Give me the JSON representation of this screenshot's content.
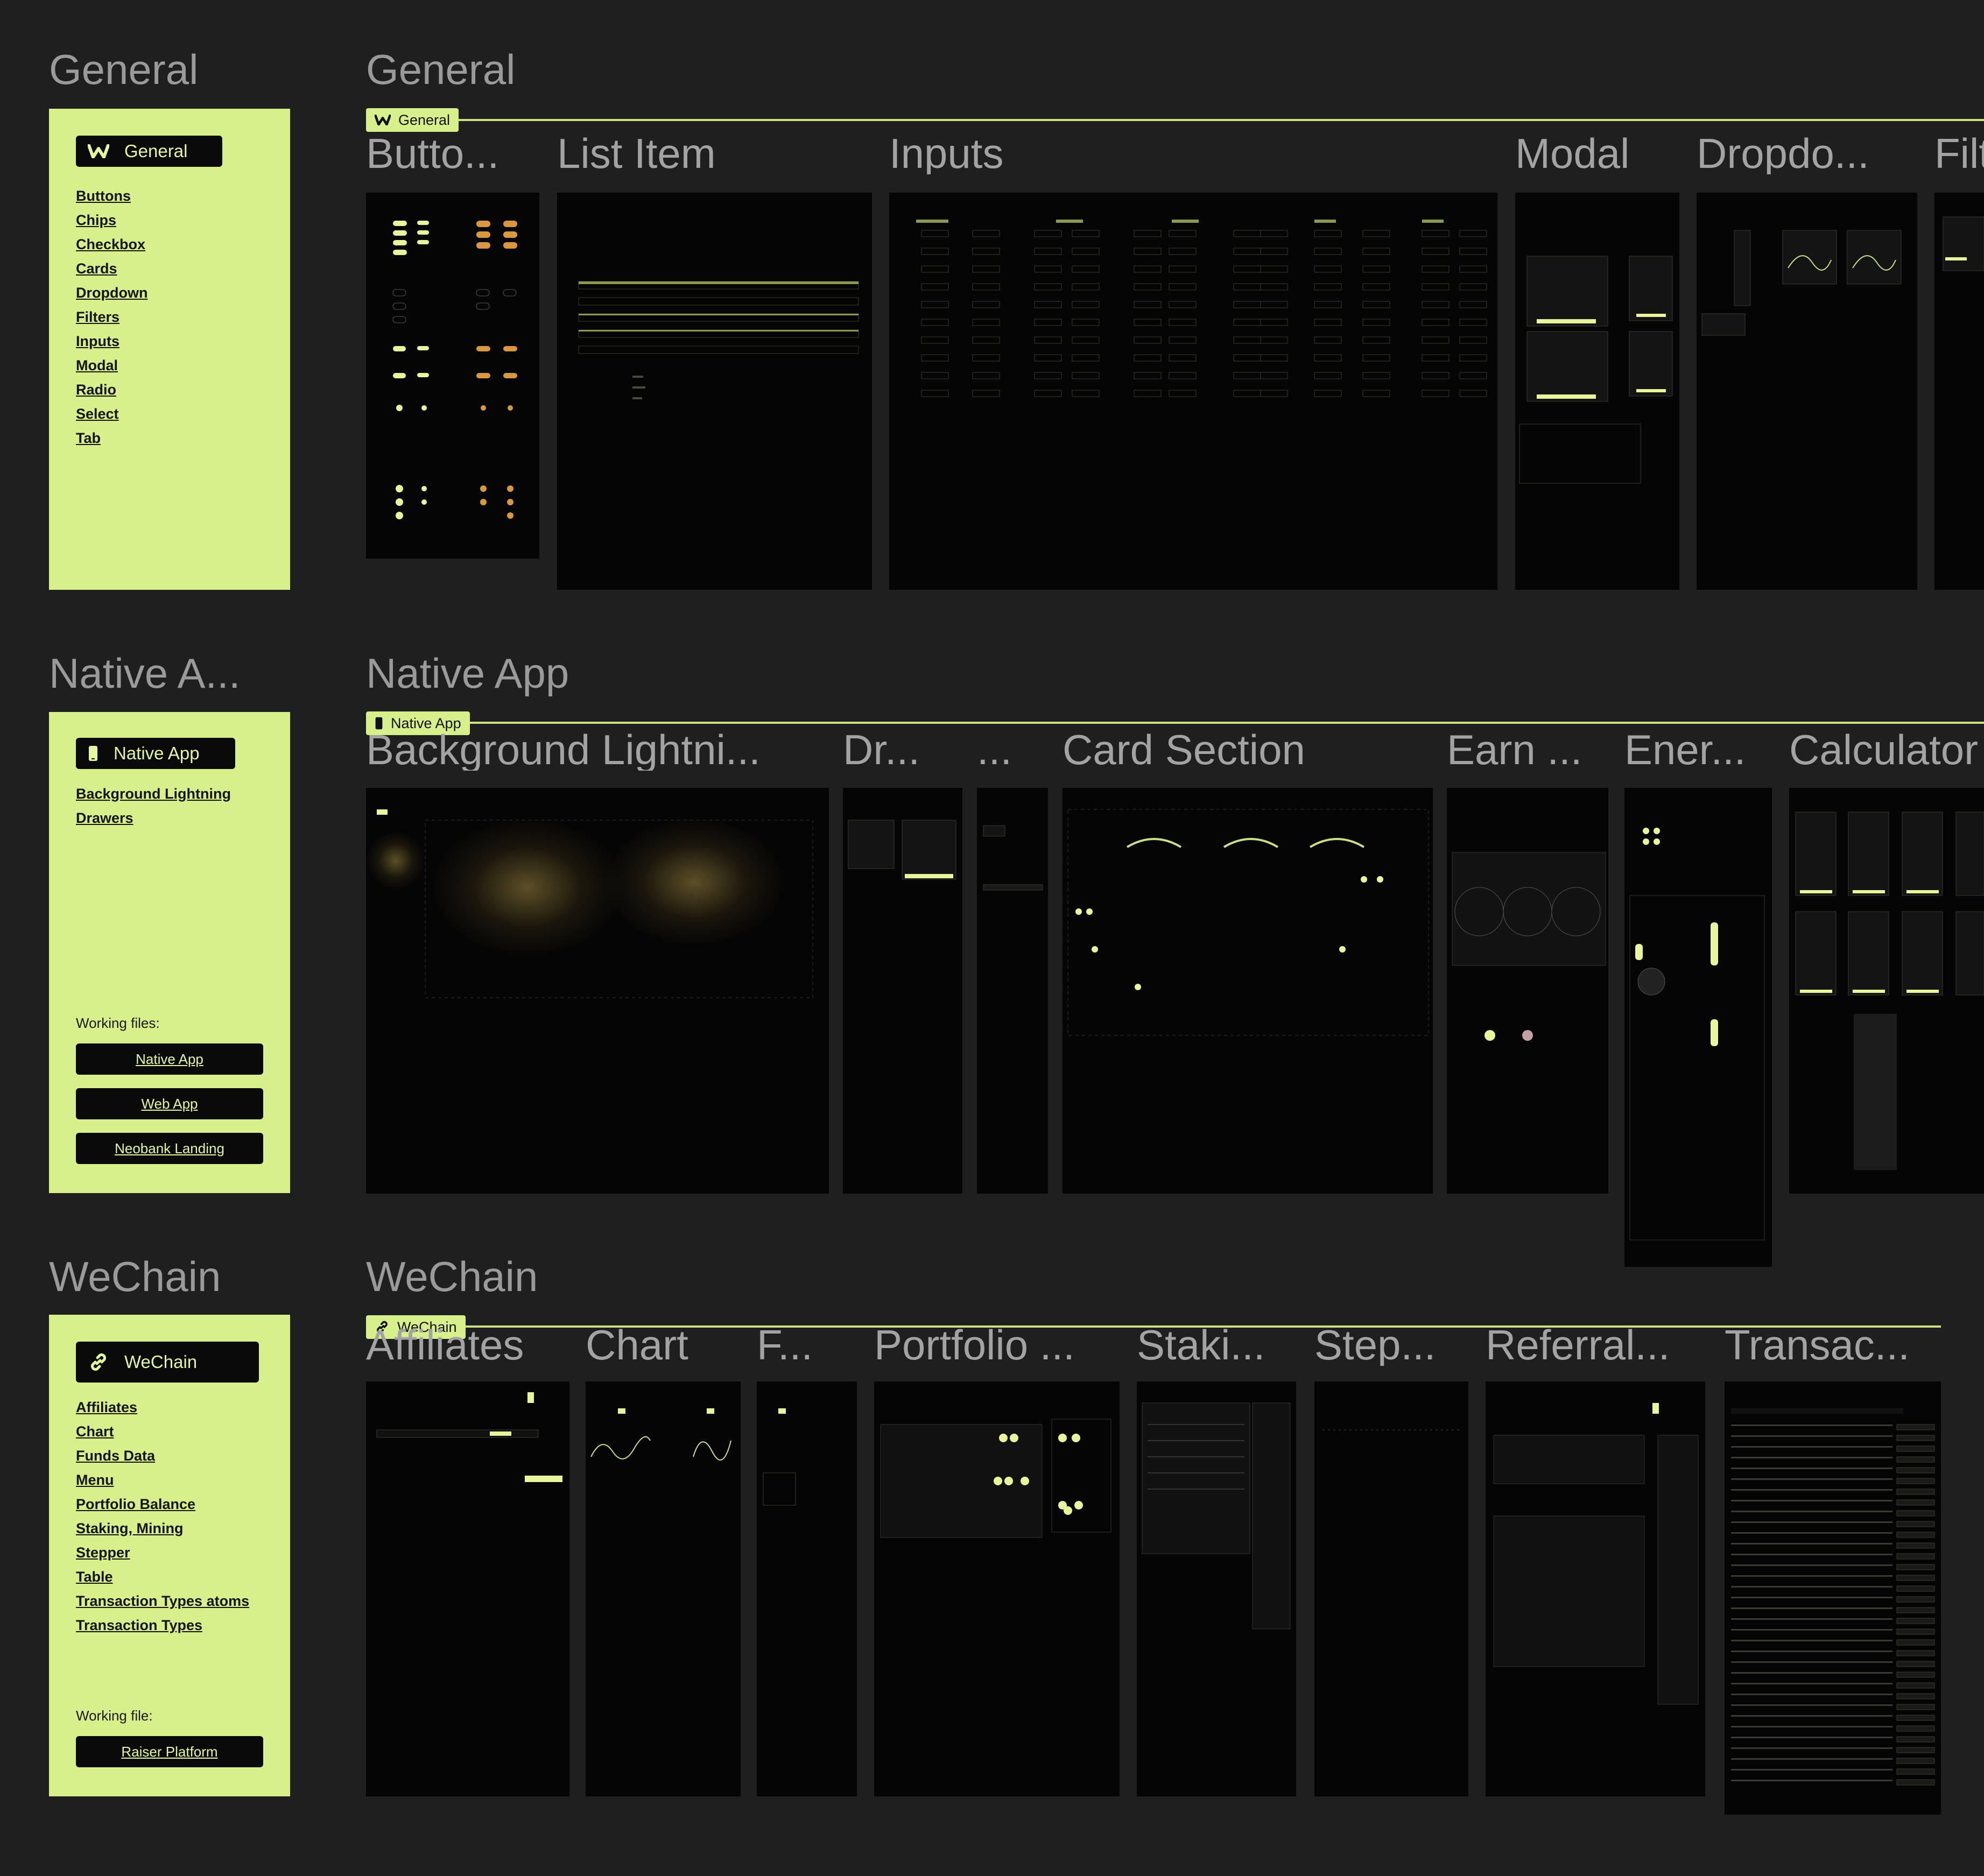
{
  "sections": {
    "general": {
      "label": "General",
      "board_title": "General",
      "tag": "General",
      "nav_header": "General",
      "nav_items": [
        "Buttons",
        "Chips",
        "Checkbox",
        "Cards",
        "Dropdown",
        "Filters",
        "Inputs",
        "Modal",
        "Radio",
        "Select",
        "Tab"
      ],
      "frames": [
        "Butto...",
        "List Item",
        "Inputs",
        "Modal",
        "Dropdo...",
        "Filt"
      ]
    },
    "native": {
      "label": "Native A...",
      "board_title": "Native App",
      "tag": "Native App",
      "nav_header": "Native App",
      "nav_items": [
        "Background Lightning",
        "Drawers"
      ],
      "working_label": "Working files:",
      "working_files": [
        "Native App",
        "Web App",
        "Neobank Landing"
      ],
      "frames": [
        "Background Lightni...",
        "Dr...",
        "...",
        "Card Section",
        "Earn ...",
        "Ener...",
        "Calculator"
      ]
    },
    "wechain": {
      "label": "WeChain",
      "board_title": "WeChain",
      "tag": "WeChain",
      "nav_header": "WeChain",
      "nav_items": [
        "Affiliates",
        "Chart",
        "Funds Data",
        "Menu",
        "Portfolio Balance",
        "Staking, Mining",
        "Stepper",
        "Table",
        "Transaction Types atoms",
        "Transaction Types"
      ],
      "working_label": "Working file:",
      "working_files": [
        "Raiser Platform"
      ],
      "frames": [
        "Affiliates",
        "Chart",
        "F...",
        "Portfolio ...",
        "Staki...",
        "Step...",
        "Referral...",
        "Transac..."
      ]
    }
  },
  "colors": {
    "canvas": "#1f1f1f",
    "accent": "#d8f08c",
    "frame": "#050505",
    "label": "#9a9a9a"
  },
  "icons": {
    "general": "brand-w-icon",
    "native": "phone-icon",
    "wechain": "link-icon"
  }
}
